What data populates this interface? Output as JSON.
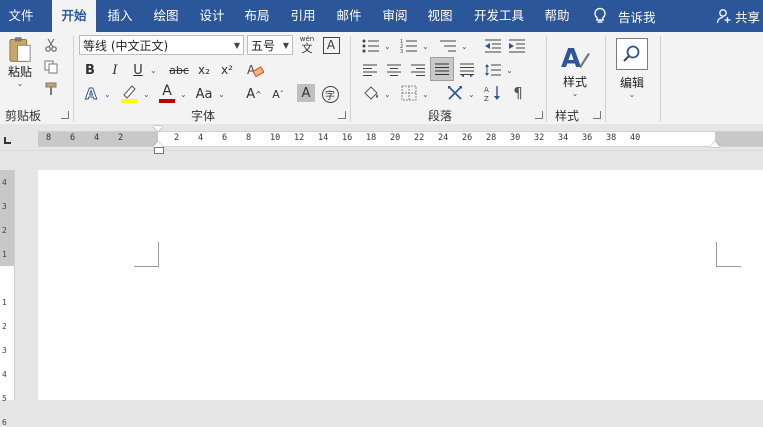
{
  "tabs": [
    {
      "label": "文件"
    },
    {
      "label": "开始"
    },
    {
      "label": "插入"
    },
    {
      "label": "绘图"
    },
    {
      "label": "设计"
    },
    {
      "label": "布局"
    },
    {
      "label": "引用"
    },
    {
      "label": "邮件"
    },
    {
      "label": "审阅"
    },
    {
      "label": "视图"
    },
    {
      "label": "开发工具"
    },
    {
      "label": "帮助"
    }
  ],
  "active_tab": "开始",
  "tell_me": "告诉我",
  "share": "共享",
  "clipboard": {
    "paste_label": "粘贴",
    "group_label": "剪贴板"
  },
  "font": {
    "font_name": "等线 (中文正文)",
    "font_size": "五号",
    "wen_label": "wén",
    "group_label": "字体",
    "bold": "B",
    "italic": "I",
    "underline": "U",
    "strike": "abc",
    "subscript": "x₂",
    "superscript": "x²",
    "grow": "A",
    "shrink": "A",
    "case": "Aa",
    "clear": "A"
  },
  "paragraph": {
    "group_label": "段落"
  },
  "styles": {
    "button_label": "样式",
    "group_label": "样式"
  },
  "editing": {
    "button_label": "编辑"
  },
  "ruler": {
    "numbers": [
      "8",
      "6",
      "4",
      "2",
      "2",
      "4",
      "6",
      "8",
      "10",
      "12",
      "14",
      "16",
      "18",
      "20",
      "22",
      "24",
      "26",
      "28",
      "30",
      "32",
      "34",
      "36",
      "38",
      "40"
    ],
    "vertical_numbers": [
      "4",
      "3",
      "2",
      "1",
      "1",
      "2",
      "3",
      "4",
      "5",
      "6"
    ]
  },
  "colors": {
    "tab_bar": "#2b579a",
    "ribbon": "#f3f3f3",
    "highlight": "#ffff00",
    "font_color": "#c00000",
    "accent": "#2b579a"
  }
}
